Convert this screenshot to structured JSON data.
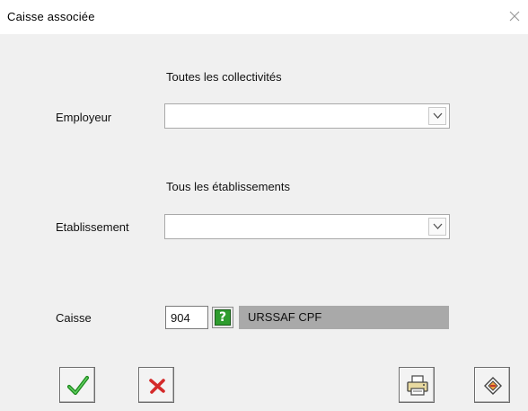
{
  "window": {
    "title": "Caisse associée",
    "close_icon": "close-icon"
  },
  "employeur": {
    "caption": "Toutes les collectivités",
    "label": "Employeur",
    "value": ""
  },
  "etablissement": {
    "caption": "Tous les établissements",
    "label": "Etablissement",
    "value": ""
  },
  "caisse": {
    "label": "Caisse",
    "code": "904",
    "help_icon": "help-icon",
    "name": "URSSAF CPF"
  },
  "buttons": {
    "validate_icon": "checkmark-icon",
    "cancel_icon": "cross-icon",
    "print_icon": "printer-icon",
    "exit_icon": "exit-icon"
  },
  "colors": {
    "panel": "#f0f0f0",
    "readonly_field": "#a9a9a9",
    "accent_green": "#2e9c2e",
    "cancel_red": "#d42a2a"
  }
}
